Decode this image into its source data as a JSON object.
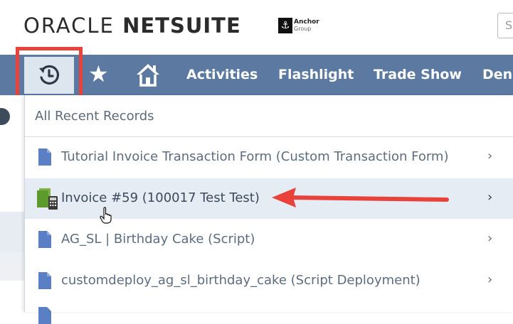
{
  "header": {
    "brand_oracle": "ORACLE",
    "brand_netsuite": "NETSUITE",
    "company_name": "Anchor",
    "company_sub": "Group",
    "search_placeholder": "S"
  },
  "navbar": {
    "items": [
      {
        "label": "Activities"
      },
      {
        "label": "Flashlight"
      },
      {
        "label": "Trade Show"
      },
      {
        "label": "Deni"
      }
    ]
  },
  "recent_menu": {
    "header": "All Recent Records",
    "items": [
      {
        "label": "Tutorial Invoice Transaction Form (Custom Transaction Form)",
        "icon": "document-icon"
      },
      {
        "label": "Invoice #59 (100017 Test Test)",
        "icon": "invoice-icon"
      },
      {
        "label": "AG_SL | Birthday Cake (Script)",
        "icon": "document-icon"
      },
      {
        "label": "customdeploy_ag_sl_birthday_cake (Script Deployment)",
        "icon": "document-icon"
      }
    ],
    "chevron": "›"
  },
  "colors": {
    "navbar": "#5c7aa1",
    "highlight": "#e8423b",
    "active_row": "#e6ecf4",
    "doc_icon": "#5b7fc4"
  }
}
